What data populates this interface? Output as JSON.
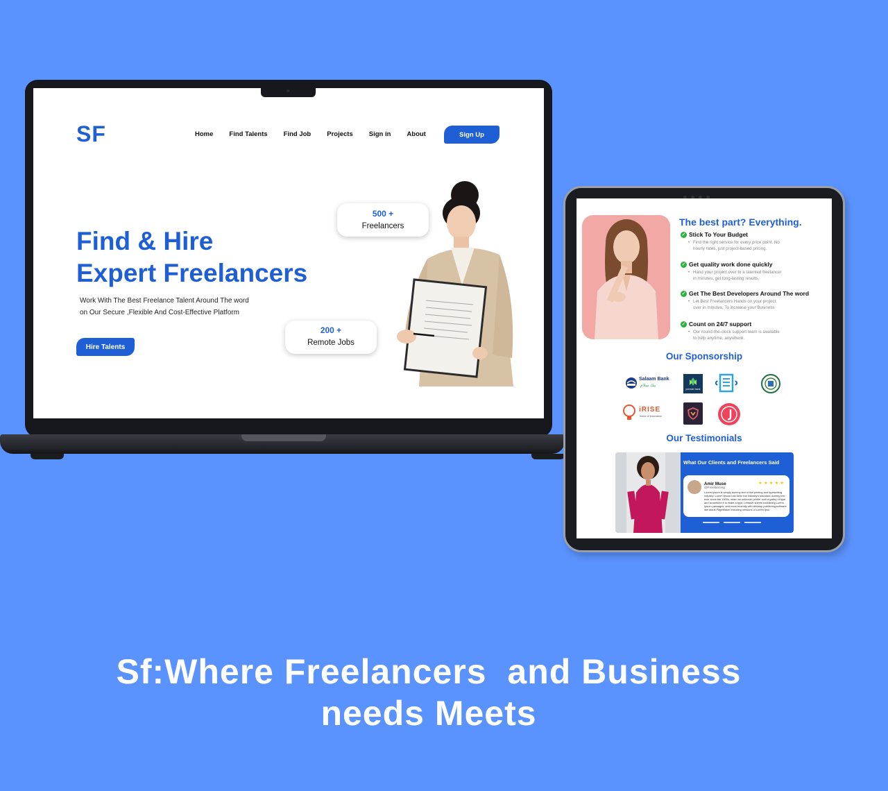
{
  "laptop_site": {
    "logo": "SF",
    "nav": [
      "Home",
      "Find Talents",
      "Find Job",
      "Projects",
      "Sign in",
      "About"
    ],
    "signup_label": "Sign Up",
    "hero_title_line1": "Find & Hire",
    "hero_title_line2": "Expert Freelancers",
    "hero_subtitle_line1": "Work With The  Best Freelance Talent Around The word",
    "hero_subtitle_line2": "on Our Secure ,Flexible And Cost-Effective Platform",
    "hire_label": "Hire  Talents",
    "stats": [
      {
        "number": "500 +",
        "label": "Freelancers"
      },
      {
        "number": "200 +",
        "label": "Remote Jobs"
      }
    ]
  },
  "tablet_site": {
    "heading": "The best part? Everything.",
    "features": [
      {
        "title": "Stick To Your Budget",
        "desc": "Find the right service for every price point. No hourly rates, just project-based pricing."
      },
      {
        "title": "Get quality work done quickly",
        "desc": "Hand your project over to a talented freelancer in minutes, get long-lasting results."
      },
      {
        "title": "Get The Best Developers Around The word",
        "desc": "Let Best Freelancers Hands on your project over  in minutes, To increase your Business"
      },
      {
        "title": "Count on 24/7 support",
        "desc": "Our round-the-clock support team is available to help anytime, anywhere."
      }
    ],
    "sponsorship_title": "Our Sponsorship",
    "sponsors": {
      "salaam_name": "Salaam Bank",
      "salaam_arabic": "بنك سلام",
      "premier": "premier bank",
      "irise": "iRISE",
      "irise_tag": "home of innovation"
    },
    "testimonials_title": "Our Testimonials",
    "testimonial": {
      "header": "What Our Clients and Freelancers Said",
      "name": "Amir Muse",
      "handle": "@Freelancing",
      "stars": "★★★★★",
      "text": "Lorem Ipsum is simply dummy text of the printing and typesetting industry. Lorem Ipsum has been the industry's standard dummy text ever since the 1500s, when an unknown printer took a galley of type and scrambled it to make a type. Letraset sheets containing Lorem Ipsum passages, and more recently with desktop publishing software like Aldus PageMaker including versions of Lorem Ipsu"
    }
  },
  "tagline_line1": "Sf:Where Freelancers  and Business",
  "tagline_line2": "needs Meets",
  "colors": {
    "background": "#5b93fe",
    "brand_blue": "#1f5fd6",
    "check_green": "#29b33d",
    "star_yellow": "#f5c518"
  }
}
